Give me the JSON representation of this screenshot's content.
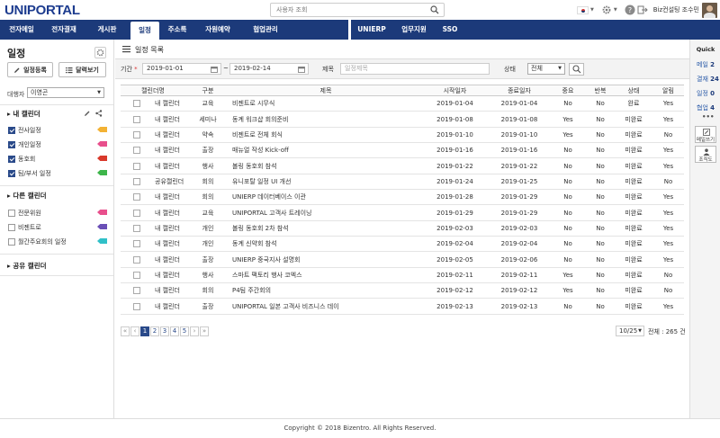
{
  "logo": "UNIPORTAL",
  "search": {
    "placeholder": "사용자 조회"
  },
  "user": {
    "name": "Biz컨설팅 조수민"
  },
  "nav": {
    "items": [
      "전자메일",
      "전자결재",
      "게시판",
      "일정",
      "주소록",
      "자원예약",
      "협업관리"
    ],
    "items2": [
      "UNIERP",
      "업무지원",
      "SSO"
    ]
  },
  "sidebar": {
    "title": "일정",
    "register_btn": "일정등록",
    "month_btn": "달력보기",
    "owner_label": "대행자",
    "owner_value": "이영곤",
    "my_cal_title": "내 캘린더",
    "my_cals": [
      {
        "name": "전사일정",
        "color": "#f3b234"
      },
      {
        "name": "개인일정",
        "color": "#e84f8c"
      },
      {
        "name": "동호회",
        "color": "#d9392b"
      },
      {
        "name": "팀/부서 일정",
        "color": "#3db54a"
      }
    ],
    "other_cal_title": "다른 캘린더",
    "other_cals": [
      {
        "name": "전문위원",
        "color": "#e84f8c"
      },
      {
        "name": "비젠트로",
        "color": "#6a4fb6"
      },
      {
        "name": "월간주요회의 일정",
        "color": "#30c0c8"
      }
    ],
    "shared_cal_title": "공유 캘린더"
  },
  "main": {
    "title": "일정 목록",
    "filter": {
      "period_label": "기간",
      "start_date": "2019-01-01",
      "end_date": "2019-02-14",
      "tilde": "~",
      "subject_label": "제목",
      "subject_placeholder": "일정제목",
      "status_label": "상태",
      "status_value": "전체"
    },
    "columns": [
      "캘린더명",
      "구분",
      "제목",
      "시작일자",
      "종료일자",
      "중요",
      "반복",
      "상태",
      "알림"
    ],
    "rows": [
      {
        "cal": "내 캘린더",
        "type": "교육",
        "title": "비젠트로 시무식",
        "start": "2019-01-04",
        "end": "2019-01-04",
        "imp": "No",
        "rep": "No",
        "status": "완료",
        "alarm": "Yes"
      },
      {
        "cal": "내 캘린더",
        "type": "세미나",
        "title": "동계 워크샵 회의준비",
        "start": "2019-01-08",
        "end": "2019-01-08",
        "imp": "Yes",
        "rep": "No",
        "status": "미완료",
        "alarm": "Yes"
      },
      {
        "cal": "내 캘린더",
        "type": "약속",
        "title": "비젠트로 전체 회식",
        "start": "2019-01-10",
        "end": "2019-01-10",
        "imp": "Yes",
        "rep": "No",
        "status": "미완료",
        "alarm": "No"
      },
      {
        "cal": "내 캘린더",
        "type": "출장",
        "title": "매뉴얼 작성 Kick-off",
        "start": "2019-01-16",
        "end": "2019-01-16",
        "imp": "No",
        "rep": "No",
        "status": "미완료",
        "alarm": "Yes"
      },
      {
        "cal": "내 캘린더",
        "type": "행사",
        "title": "볼링 동호회 참석",
        "start": "2019-01-22",
        "end": "2019-01-22",
        "imp": "No",
        "rep": "No",
        "status": "미완료",
        "alarm": "Yes"
      },
      {
        "cal": "공유캘린더",
        "type": "회의",
        "title": "유니포탈 일정 UI 개선",
        "start": "2019-01-24",
        "end": "2019-01-25",
        "imp": "No",
        "rep": "No",
        "status": "미완료",
        "alarm": "No"
      },
      {
        "cal": "내 캘린더",
        "type": "회의",
        "title": "UNIERP 데이터베이스 이관",
        "start": "2019-01-28",
        "end": "2019-01-29",
        "imp": "No",
        "rep": "No",
        "status": "미완료",
        "alarm": "Yes"
      },
      {
        "cal": "내 캘린더",
        "type": "교육",
        "title": "UNIPORTAL 고객사 트레이닝",
        "start": "2019-01-29",
        "end": "2019-01-29",
        "imp": "No",
        "rep": "No",
        "status": "미완료",
        "alarm": "Yes"
      },
      {
        "cal": "내 캘린더",
        "type": "개인",
        "title": "볼링 동호회 2차 참석",
        "start": "2019-02-03",
        "end": "2019-02-03",
        "imp": "No",
        "rep": "No",
        "status": "미완료",
        "alarm": "Yes"
      },
      {
        "cal": "내 캘린더",
        "type": "개인",
        "title": "동계 신약회 참석",
        "start": "2019-02-04",
        "end": "2019-02-04",
        "imp": "No",
        "rep": "No",
        "status": "미완료",
        "alarm": "Yes"
      },
      {
        "cal": "내 캘린더",
        "type": "출장",
        "title": "UNIERP 중국지사 설명회",
        "start": "2019-02-05",
        "end": "2019-02-06",
        "imp": "No",
        "rep": "No",
        "status": "미완료",
        "alarm": "Yes"
      },
      {
        "cal": "내 캘린더",
        "type": "행사",
        "title": "스마트 팩토리 행사 코엑스",
        "start": "2019-02-11",
        "end": "2019-02-11",
        "imp": "Yes",
        "rep": "No",
        "status": "미완료",
        "alarm": "No"
      },
      {
        "cal": "내 캘린더",
        "type": "회의",
        "title": "P4팀 주간회의",
        "start": "2019-02-12",
        "end": "2019-02-12",
        "imp": "Yes",
        "rep": "No",
        "status": "미완료",
        "alarm": "No"
      },
      {
        "cal": "내 캘린더",
        "type": "출장",
        "title": "UNIPORTAL 일본 고객사 비즈니스 데이",
        "start": "2019-02-13",
        "end": "2019-02-13",
        "imp": "No",
        "rep": "No",
        "status": "미완료",
        "alarm": "Yes"
      }
    ],
    "pages": [
      "1",
      "2",
      "3",
      "4",
      "5"
    ],
    "page_size": "10/25",
    "total": "전체 : 265 건"
  },
  "quick": {
    "title": "Quick",
    "items": [
      {
        "label": "메일",
        "count": "2"
      },
      {
        "label": "결재",
        "count": "24"
      },
      {
        "label": "일정",
        "count": "0"
      },
      {
        "label": "협업",
        "count": "4"
      }
    ],
    "dots": "•••",
    "write_btn": "메일쓰기",
    "org_btn": "조직도"
  },
  "footer": "Copyright © 2018 Bizentro. All Rights Reserved.",
  "colors": {
    "nav": "#1c3a7a",
    "accent": "#2a4a8a"
  }
}
